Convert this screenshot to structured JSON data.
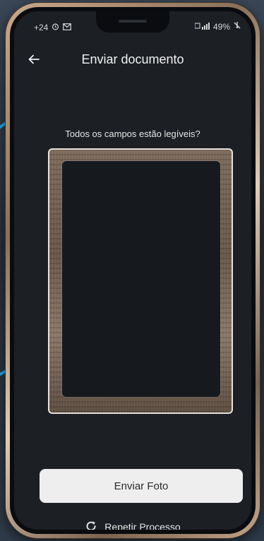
{
  "status_bar": {
    "time": "+24",
    "battery": "49%"
  },
  "header": {
    "title": "Enviar documento",
    "back_icon": "arrow-left-icon"
  },
  "main": {
    "prompt": "Todos os campos estão legíveis?"
  },
  "actions": {
    "send_label": "Enviar Foto",
    "retry_label": "Repetir Processo",
    "retry_icon": "refresh-icon"
  }
}
